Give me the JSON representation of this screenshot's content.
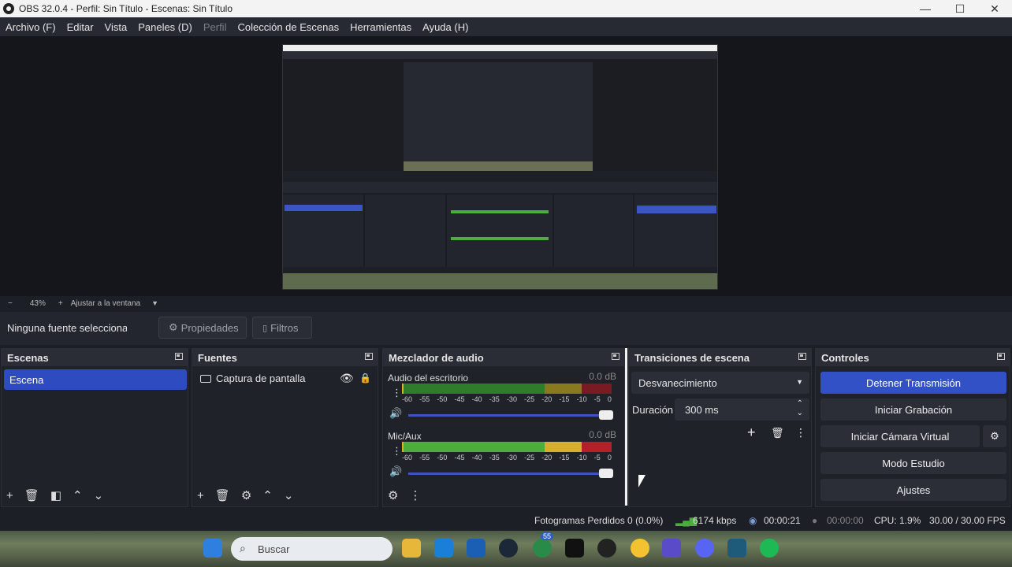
{
  "window": {
    "title": "OBS 32.0.4 - Perfil: Sin Título - Escenas: Sin Título"
  },
  "menu": [
    {
      "label": "Archivo (F)",
      "enabled": true
    },
    {
      "label": "Editar",
      "enabled": true
    },
    {
      "label": "Vista",
      "enabled": true
    },
    {
      "label": "Paneles (D)",
      "enabled": true
    },
    {
      "label": "Perfil",
      "enabled": false
    },
    {
      "label": "Colección de Escenas",
      "enabled": true
    },
    {
      "label": "Herramientas",
      "enabled": true
    },
    {
      "label": "Ayuda (H)",
      "enabled": true
    }
  ],
  "zoom": {
    "minus": "−",
    "value": "43%",
    "plus": "+",
    "fit_label": "Ajustar a la ventana"
  },
  "source_toolbar": {
    "no_source": "Ninguna fuente seleccionada",
    "properties": "Propiedades",
    "filters": "Filtros"
  },
  "scenes": {
    "title": "Escenas",
    "items": [
      "Escena"
    ]
  },
  "sources": {
    "title": "Fuentes",
    "items": [
      {
        "name": "Captura de pantalla"
      }
    ]
  },
  "mixer": {
    "title": "Mezclador de audio",
    "channels": [
      {
        "name": "Audio del escritorio",
        "db": "0.0 dB"
      },
      {
        "name": "Mic/Aux",
        "db": "0.0 dB"
      }
    ],
    "ticks": [
      "-60",
      "-55",
      "-50",
      "-45",
      "-40",
      "-35",
      "-30",
      "-25",
      "-20",
      "-15",
      "-10",
      "-5",
      "0"
    ]
  },
  "transitions": {
    "title": "Transiciones de escena",
    "selected": "Desvanecimiento",
    "duration_label": "Duración",
    "duration_value": "300 ms"
  },
  "controls": {
    "title": "Controles",
    "stop_stream": "Detener Transmisión",
    "start_recording": "Iniciar Grabación",
    "start_virtual_cam": "Iniciar Cámara Virtual",
    "studio_mode": "Modo Estudio",
    "settings": "Ajustes"
  },
  "status": {
    "dropped": "Fotogramas Perdidos 0 (0.0%)",
    "bitrate": "6174 kbps",
    "stream_time": "00:00:21",
    "rec_time": "00:00:00",
    "cpu": "CPU: 1.9%",
    "fps": "30.00 / 30.00 FPS"
  },
  "taskbar": {
    "search_placeholder": "Buscar",
    "badge": "55"
  },
  "colors": {
    "accent": "#3b55c4",
    "meter_green": "#4caf3c",
    "meter_yellow": "#c9a227",
    "meter_red": "#b3202a"
  }
}
